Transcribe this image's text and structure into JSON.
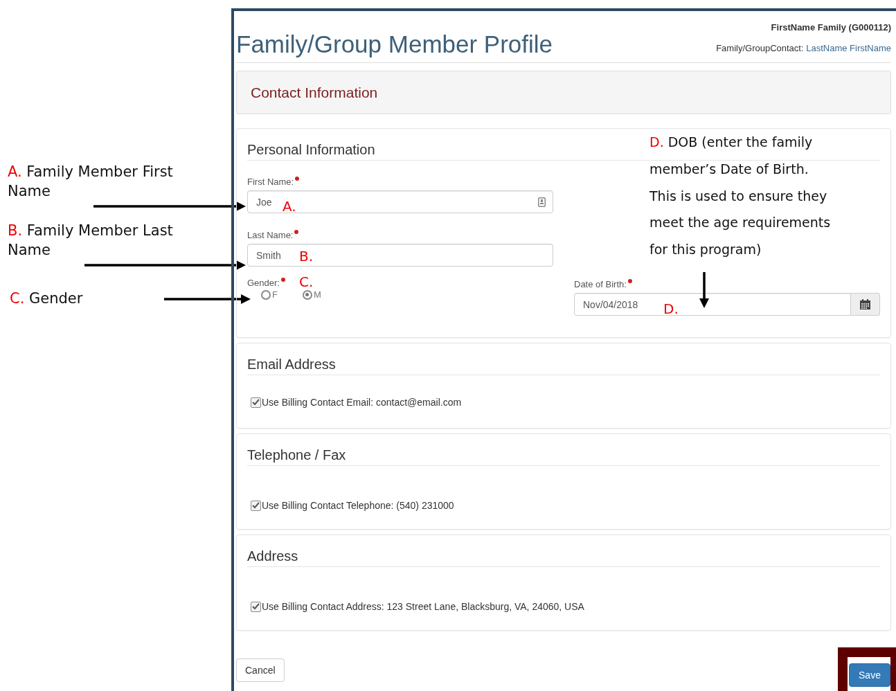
{
  "callouts": [
    {
      "letter": "A.",
      "text": "Family Member First Name"
    },
    {
      "letter": "B.",
      "text": "Family Member Last Name"
    },
    {
      "letter": "C.",
      "text": "Gender"
    }
  ],
  "dob_note": {
    "letter": "D.",
    "text": "DOB (enter the family member’s Date of Birth.  This is used to ensure they meet the age requirements for this program)"
  },
  "header": {
    "title": "Family/Group Member Profile",
    "family": "FirstName Family (G000112)",
    "contact_label": "Family/GroupContact:",
    "contact_name": "LastName FirstName"
  },
  "section_title": "Contact Information",
  "personal": {
    "heading": "Personal Information",
    "first_name": {
      "label": "First Name:",
      "value": "Joe",
      "marker": "A."
    },
    "last_name": {
      "label": "Last Name:",
      "value": "Smith",
      "marker": "B."
    },
    "gender": {
      "label": "Gender:",
      "marker": "C.",
      "options": [
        {
          "label": "F",
          "selected": false
        },
        {
          "label": "M",
          "selected": true
        }
      ]
    },
    "dob": {
      "label": "Date of Birth:",
      "value": "Nov/04/2018",
      "marker": "D."
    }
  },
  "panels": [
    {
      "heading": "Email Address",
      "checked": true,
      "text": "Use Billing Contact Email: contact@email.com"
    },
    {
      "heading": "Telephone / Fax",
      "checked": true,
      "text": "Use Billing Contact Telephone: (540) 231000"
    },
    {
      "heading": "Address",
      "checked": true,
      "text": "Use Billing Contact Address: 123 Street Lane, Blacksburg, VA, 24060, USA"
    }
  ],
  "buttons": {
    "cancel": "Cancel",
    "save": "Save",
    "save_highlighted": true
  }
}
